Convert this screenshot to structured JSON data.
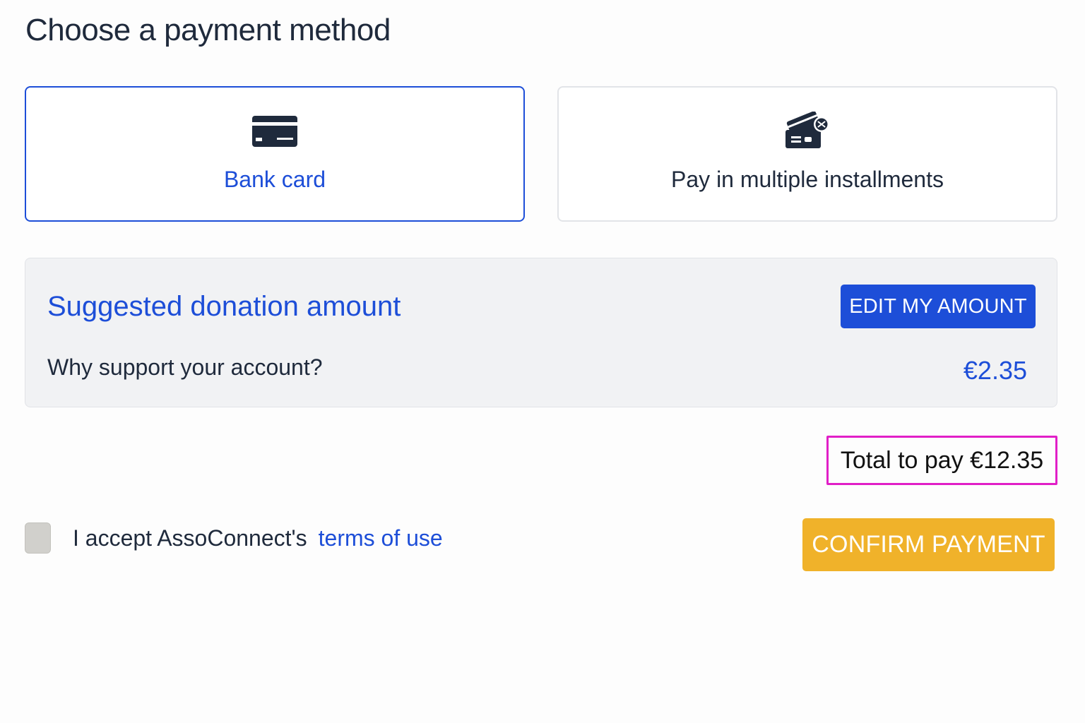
{
  "header": {
    "title": "Choose a payment method"
  },
  "payment_methods": [
    {
      "label": "Bank card",
      "icon": "credit-card-icon",
      "selected": true
    },
    {
      "label": "Pay in multiple installments",
      "icon": "installment-cards-icon",
      "selected": false
    }
  ],
  "donation": {
    "title": "Suggested donation amount",
    "edit_label": "EDIT MY AMOUNT",
    "question": "Why support your account?",
    "amount": "€2.35"
  },
  "total": {
    "text": "Total to pay €12.35"
  },
  "terms": {
    "text": "I accept AssoConnect's",
    "link_text": "terms of use",
    "checked": false
  },
  "confirm": {
    "label": "CONFIRM PAYMENT"
  },
  "colors": {
    "accent": "#1d4ed8",
    "confirm": "#f0b22a",
    "highlight": "#e11fc7",
    "panel": "#f1f2f4"
  }
}
